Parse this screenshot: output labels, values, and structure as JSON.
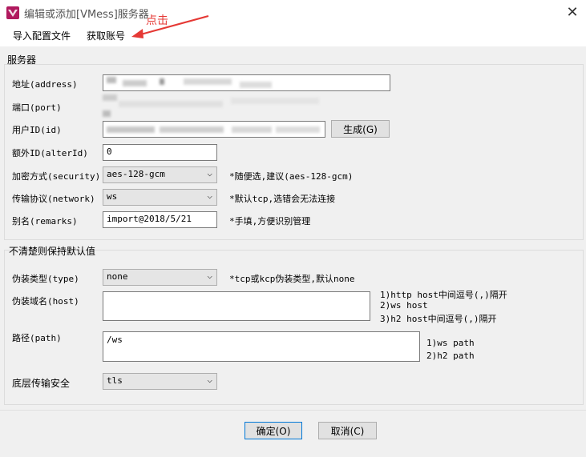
{
  "window": {
    "title": "编辑或添加[VMess]服务器",
    "close_glyph": "✕"
  },
  "menu": {
    "import_label": "导入配置文件",
    "get_account_label": "获取账号"
  },
  "annotation": {
    "text": "点击",
    "color": "#e53935"
  },
  "server_group": {
    "label": "服务器",
    "address_label": "地址(address)",
    "port_label": "端口(port)",
    "uuid_label": "用户ID(id)",
    "generate_button": "生成(G)",
    "alter_id_label": "额外ID(alterId)",
    "alter_id_value": "0",
    "security_label": "加密方式(security)",
    "security_value": "aes-128-gcm",
    "security_hint": "*随便选,建议(aes-128-gcm)",
    "network_label": "传输协议(network)",
    "network_value": "ws",
    "network_hint": "*默认tcp,选错会无法连接",
    "remarks_label": "别名(remarks)",
    "remarks_value": "import@2018/5/21",
    "remarks_hint": "*手填,方便识别管理"
  },
  "advanced_group": {
    "label": "不清楚则保持默认值",
    "type_label": "伪装类型(type)",
    "type_value": "none",
    "type_hint": "*tcp或kcp伪装类型,默认none",
    "host_label": "伪装域名(host)",
    "host_value": "",
    "host_hints": [
      "1)http host中间逗号(,)隔开",
      "2)ws host",
      "3)h2 host中间逗号(,)隔开"
    ],
    "path_label": "路径(path)",
    "path_value": "/ws",
    "path_hints": [
      "1)ws path",
      "2)h2 path"
    ],
    "tls_label": "底层传输安全",
    "tls_value": "tls"
  },
  "footer": {
    "ok_button": "确定(O)",
    "cancel_button": "取消(C)"
  },
  "icons": {
    "app": "v2rayn-app-icon",
    "close": "close-icon",
    "dropdown": "chevron-down-icon",
    "annotation": "red-arrow-annotation"
  }
}
